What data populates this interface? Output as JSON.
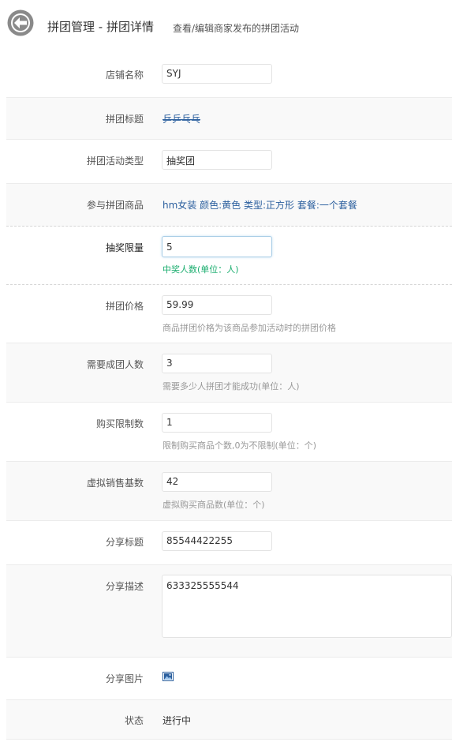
{
  "header": {
    "title": "拼团管理 - 拼团详情",
    "subtitle": "查看/编辑商家发布的拼团活动"
  },
  "form": {
    "shop_name": {
      "label": "店铺名称",
      "value": "SYJ"
    },
    "group_title": {
      "label": "拼团标题",
      "value": "乒乒乓乓"
    },
    "activity_type": {
      "label": "拼团活动类型",
      "value": "抽奖团"
    },
    "product": {
      "label": "参与拼团商品",
      "value": "hm女装 颜色:黄色 类型:正方形 套餐:一个套餐"
    },
    "lottery_limit": {
      "label": "抽奖限量",
      "value": "5",
      "help": "中奖人数(单位：人)"
    },
    "group_price": {
      "label": "拼团价格",
      "value": "59.99",
      "help": "商品拼团价格为该商品参加活动时的拼团价格"
    },
    "required_members": {
      "label": "需要成团人数",
      "value": "3",
      "help": "需要多少人拼团才能成功(单位：人)"
    },
    "purchase_limit": {
      "label": "购买限制数",
      "value": "1",
      "help": "限制购买商品个数,0为不限制(单位：个)"
    },
    "virtual_sales": {
      "label": "虚拟销售基数",
      "value": "42",
      "help": "虚拟购买商品数(单位：个)"
    },
    "share_title": {
      "label": "分享标题",
      "value": "85544422255"
    },
    "share_desc": {
      "label": "分享描述",
      "value": "633325555544"
    },
    "share_image": {
      "label": "分享图片",
      "icon": "image-icon"
    },
    "status": {
      "label": "状态",
      "value": "进行中"
    }
  },
  "colors": {
    "link": "#2b5f9e",
    "help_green": "#1aad6e",
    "help_gray": "#999999",
    "back_icon": "#8a8a8a"
  }
}
